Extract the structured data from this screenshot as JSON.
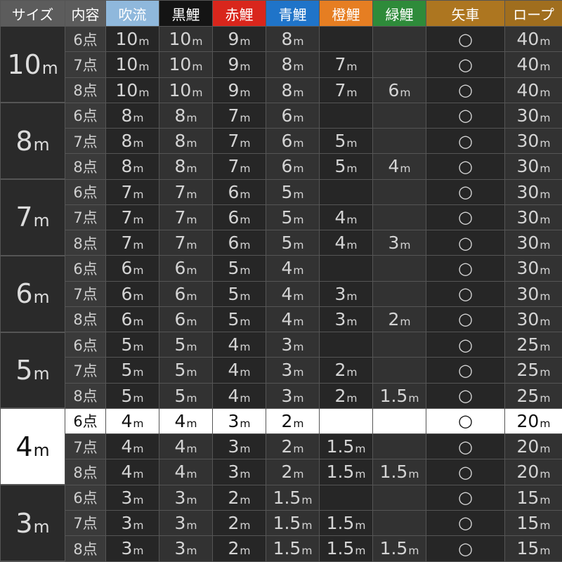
{
  "headers": [
    {
      "label": "サイズ",
      "bg": "#5c5c5c"
    },
    {
      "label": "内容",
      "bg": "#5c5c5c"
    },
    {
      "label": "吹流",
      "bg": "#8fb8dc"
    },
    {
      "label": "黒鯉",
      "bg": "#141414"
    },
    {
      "label": "赤鯉",
      "bg": "#d9261c"
    },
    {
      "label": "青鯉",
      "bg": "#1f74c9"
    },
    {
      "label": "橙鯉",
      "bg": "#e67e22"
    },
    {
      "label": "緑鯉",
      "bg": "#2e8b3a"
    },
    {
      "label": "矢車",
      "bg": "#ad7620"
    },
    {
      "label": "ロープ",
      "bg": "#a06e1e"
    }
  ],
  "highlight_color": "#ffffff",
  "groups": [
    {
      "size": "10m",
      "rows": [
        [
          "6点",
          "10m",
          "10m",
          "9m",
          "8m",
          "",
          "",
          "○",
          "40m"
        ],
        [
          "7点",
          "10m",
          "10m",
          "9m",
          "8m",
          "7m",
          "",
          "○",
          "40m"
        ],
        [
          "8点",
          "10m",
          "10m",
          "9m",
          "8m",
          "7m",
          "6m",
          "○",
          "40m"
        ]
      ]
    },
    {
      "size": "8m",
      "rows": [
        [
          "6点",
          "8m",
          "8m",
          "7m",
          "6m",
          "",
          "",
          "○",
          "30m"
        ],
        [
          "7点",
          "8m",
          "8m",
          "7m",
          "6m",
          "5m",
          "",
          "○",
          "30m"
        ],
        [
          "8点",
          "8m",
          "8m",
          "7m",
          "6m",
          "5m",
          "4m",
          "○",
          "30m"
        ]
      ]
    },
    {
      "size": "7m",
      "rows": [
        [
          "6点",
          "7m",
          "7m",
          "6m",
          "5m",
          "",
          "",
          "○",
          "30m"
        ],
        [
          "7点",
          "7m",
          "7m",
          "6m",
          "5m",
          "4m",
          "",
          "○",
          "30m"
        ],
        [
          "8点",
          "7m",
          "7m",
          "6m",
          "5m",
          "4m",
          "3m",
          "○",
          "30m"
        ]
      ]
    },
    {
      "size": "6m",
      "rows": [
        [
          "6点",
          "6m",
          "6m",
          "5m",
          "4m",
          "",
          "",
          "○",
          "30m"
        ],
        [
          "7点",
          "6m",
          "6m",
          "5m",
          "4m",
          "3m",
          "",
          "○",
          "30m"
        ],
        [
          "8点",
          "6m",
          "6m",
          "5m",
          "4m",
          "3m",
          "2m",
          "○",
          "30m"
        ]
      ]
    },
    {
      "size": "5m",
      "rows": [
        [
          "6点",
          "5m",
          "5m",
          "4m",
          "3m",
          "",
          "",
          "○",
          "25m"
        ],
        [
          "7点",
          "5m",
          "5m",
          "4m",
          "3m",
          "2m",
          "",
          "○",
          "25m"
        ],
        [
          "8点",
          "5m",
          "5m",
          "4m",
          "3m",
          "2m",
          "1.5m",
          "○",
          "25m"
        ]
      ]
    },
    {
      "size": "4m",
      "highlight_row": 0,
      "rows": [
        [
          "6点",
          "4m",
          "4m",
          "3m",
          "2m",
          "",
          "",
          "○",
          "20m"
        ],
        [
          "7点",
          "4m",
          "4m",
          "3m",
          "2m",
          "1.5m",
          "",
          "○",
          "20m"
        ],
        [
          "8点",
          "4m",
          "4m",
          "3m",
          "2m",
          "1.5m",
          "1.5m",
          "○",
          "20m"
        ]
      ]
    },
    {
      "size": "3m",
      "rows": [
        [
          "6点",
          "3m",
          "3m",
          "2m",
          "1.5m",
          "",
          "",
          "○",
          "15m"
        ],
        [
          "7点",
          "3m",
          "3m",
          "2m",
          "1.5m",
          "1.5m",
          "",
          "○",
          "15m"
        ],
        [
          "8点",
          "3m",
          "3m",
          "2m",
          "1.5m",
          "1.5m",
          "1.5m",
          "○",
          "15m"
        ]
      ]
    }
  ]
}
